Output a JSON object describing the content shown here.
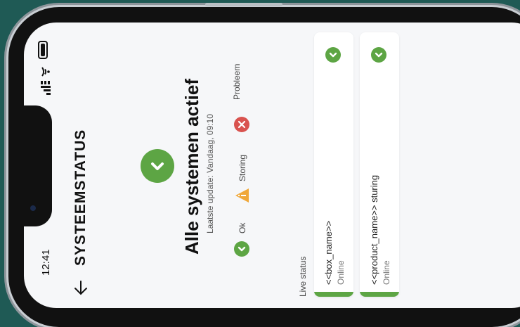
{
  "status_bar": {
    "time": "12:41",
    "icons": [
      "signal-icon",
      "wifi-icon",
      "battery-icon"
    ]
  },
  "header": {
    "back_icon": "arrow-left-icon",
    "title": "SYSTEEMSTATUS"
  },
  "summary": {
    "icon": "check-circle-icon",
    "headline": "Alle systemen actief",
    "last_update": "Laatste update: Vandaag, 09:10"
  },
  "legend": [
    {
      "label": "Ok",
      "icon": "check-circle-icon"
    },
    {
      "label": "Storing",
      "icon": "warning-icon"
    },
    {
      "label": "Probleem",
      "icon": "error-icon"
    }
  ],
  "live": {
    "label": "Live status",
    "cards": [
      {
        "name": "<<box_name>>",
        "status": "Online"
      },
      {
        "name": "<<product_name>> sturing",
        "status": "Online"
      }
    ]
  },
  "colors": {
    "ok": "#5da544",
    "warning": "#f0a83a",
    "error": "#d9534f",
    "background": "#f6f7f9",
    "outer": "#1f5a55"
  }
}
